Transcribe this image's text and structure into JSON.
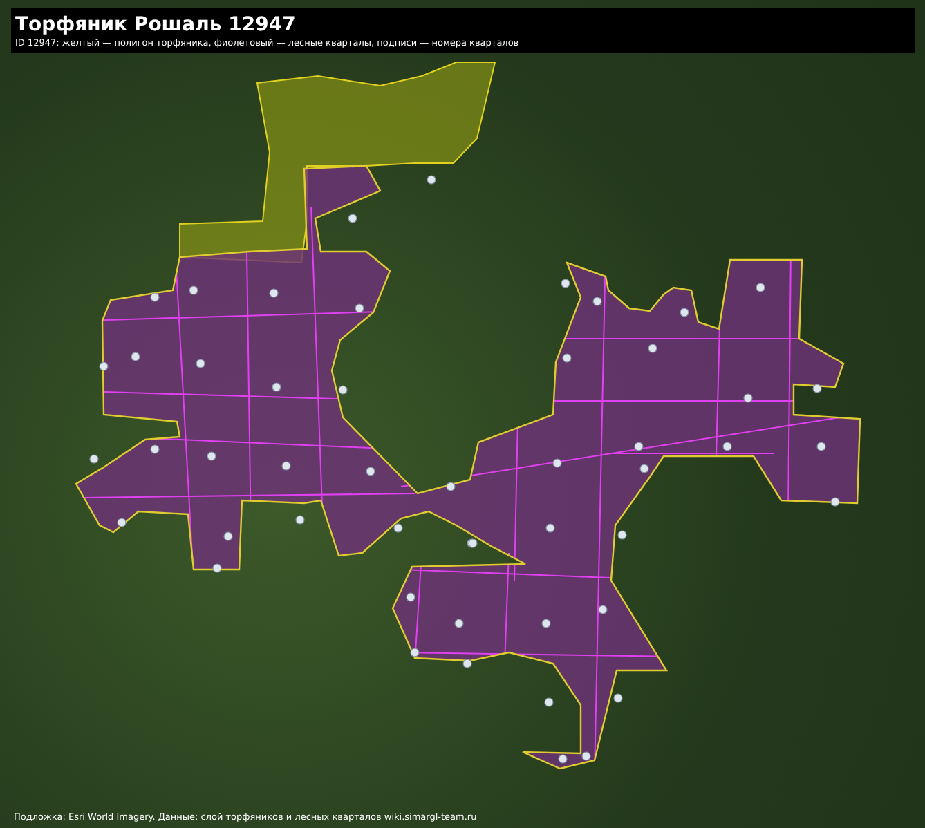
{
  "header": {
    "title": "Торфяник Рошаль 12947",
    "legend": "ID 12947: желтый — полигон торфяника, фиолетовый — лесные кварталы, подписи — номера кварталов"
  },
  "attribution": "Подложка: Esri World Imagery. Данные: слой торфяников и лесных кварталов wiki.simargl-team.ru"
}
